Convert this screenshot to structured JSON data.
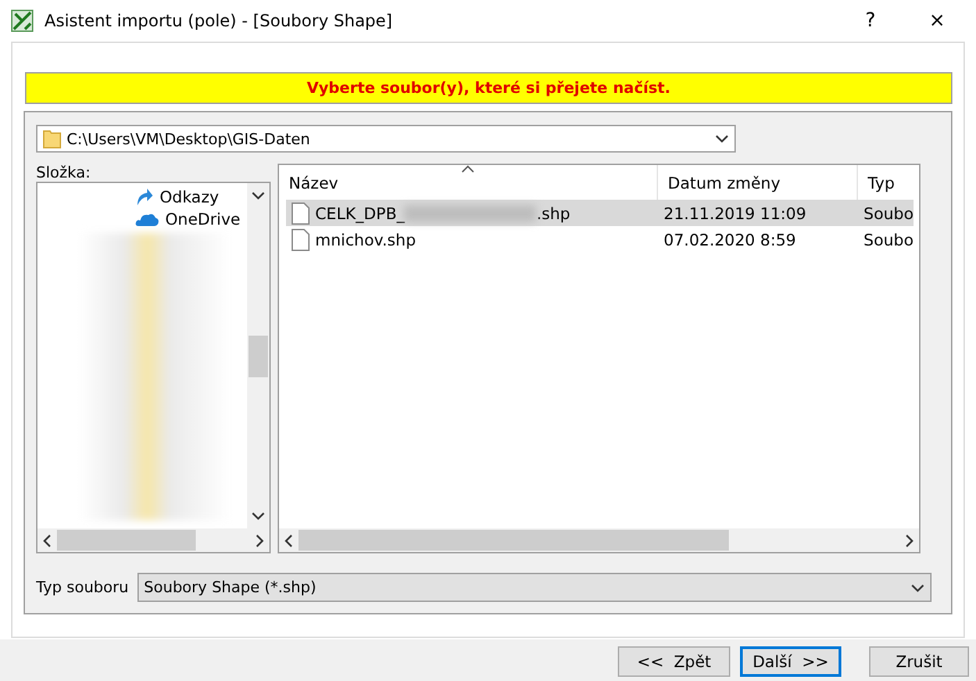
{
  "window": {
    "title": "Asistent importu (pole) - [Soubory Shape]",
    "help": "?",
    "close": "×"
  },
  "banner": "Vyberte soubor(y), které si přejete načíst.",
  "path": {
    "value": "C:\\Users\\VM\\Desktop\\GIS-Daten"
  },
  "folder_label": "Složka:",
  "tree": [
    {
      "label": "Odkazy",
      "kind": "links"
    },
    {
      "label": "OneDrive",
      "kind": "cloud"
    }
  ],
  "files": {
    "columns": [
      "Název",
      "Datum změny",
      "Typ"
    ],
    "rows": [
      {
        "name_start": "CELK_DPB_",
        "name_end": ".shp",
        "blurred": true,
        "date": "21.11.2019 11:09",
        "type": "Soubo",
        "selected": true
      },
      {
        "name_start": "mnichov.shp",
        "name_end": "",
        "blurred": false,
        "date": "07.02.2020 8:59",
        "type": "Soubo",
        "selected": false
      }
    ]
  },
  "file_type": {
    "label": "Typ souboru",
    "value": "Soubory Shape (*.shp)"
  },
  "buttons": [
    {
      "label": "<<  Zpět",
      "default": false
    },
    {
      "label": "Další  >>",
      "default": true
    },
    {
      "label": "Zrušit",
      "default": false
    }
  ]
}
